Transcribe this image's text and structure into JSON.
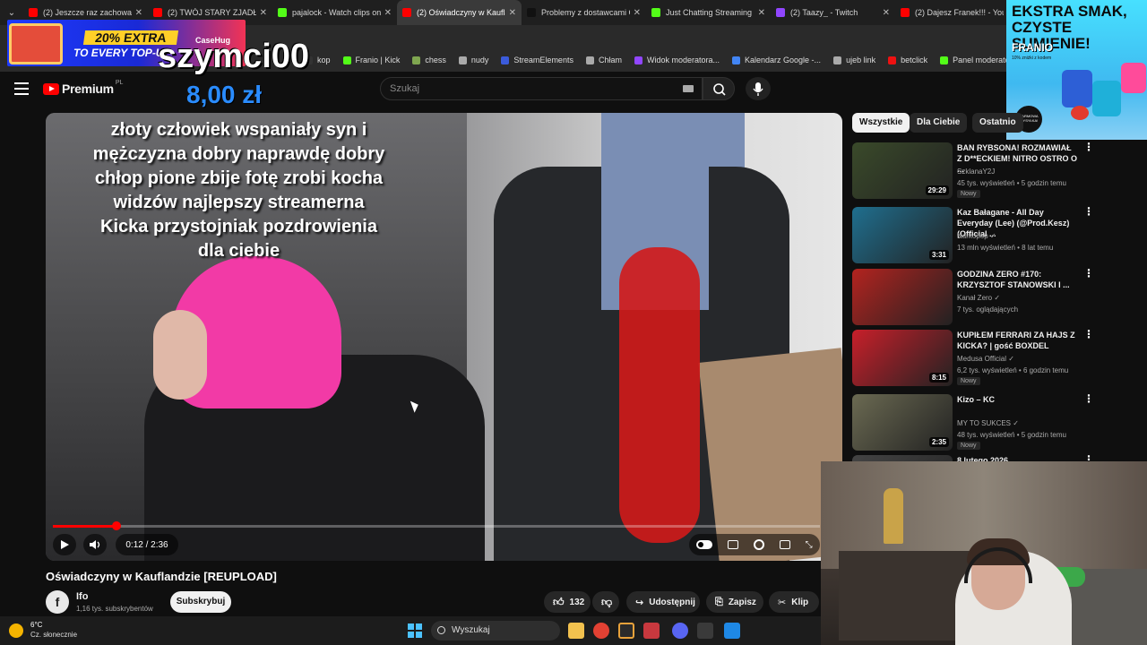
{
  "tabs": [
    {
      "title": "(2) Jeszcze raz zachowasz",
      "color": "#ff0000",
      "active": false
    },
    {
      "title": "(2) TWÓJ STARY ZJADŁ Ś",
      "color": "#ff0000",
      "active": false
    },
    {
      "title": "pajalock - Watch clips on",
      "color": "#53fc18",
      "active": false
    },
    {
      "title": "(2) Oświadczyny w Kaufla",
      "color": "#ff0000",
      "active": true
    },
    {
      "title": "Problemy z dostawcami G",
      "color": "#111111",
      "active": false
    },
    {
      "title": "Just Chatting Streaming",
      "color": "#53fc18",
      "active": false
    },
    {
      "title": "(2) Taazy_ - Twitch",
      "color": "#9146ff",
      "active": false
    },
    {
      "title": "(2) Dajesz Franek!!! - You",
      "color": "#ff0000",
      "active": false
    }
  ],
  "bookmarks": [
    {
      "label": "kop",
      "color": "#333333"
    },
    {
      "label": "Franio | Kick",
      "color": "#53fc18"
    },
    {
      "label": "chess",
      "color": "#7fa650"
    },
    {
      "label": "nudy",
      "color": "#aaaaaa"
    },
    {
      "label": "StreamElements",
      "color": "#3b5bdb"
    },
    {
      "label": "Chłam",
      "color": "#aaaaaa"
    },
    {
      "label": "Widok moderatora...",
      "color": "#9146ff"
    },
    {
      "label": "Kalendarz Google -...",
      "color": "#4285f4"
    },
    {
      "label": "ujeb link",
      "color": "#aaaaaa"
    },
    {
      "label": "betclick",
      "color": "#e11"
    },
    {
      "label": "Panel moderatora |...",
      "color": "#53fc18"
    }
  ],
  "header": {
    "logo_text": "Premium",
    "logo_region": "PL",
    "search_placeholder": "Szukaj"
  },
  "overlay": {
    "promo_line1": "20% EXTRA",
    "promo_line2": "TO EVERY TOP-UP",
    "promo_brand": "CaseHug",
    "donor_name": "szymci00",
    "donation_amount": "8,00 zł"
  },
  "ad": {
    "headline": "EKSTRA SMAK, CZYSTE SUMIENIE!",
    "brand": "FRANIO",
    "small": "10% zniżki z kodem",
    "badge": "DARMOWA WYSYŁKA!"
  },
  "video": {
    "caption": "złoty człowiek wspaniały syn i mężczyzna dobry naprawdę dobry chłop pione zbije fotę zrobi kocha widzów najlepszy streamerna Kicka przystojniak pozdrowienia dla ciebie",
    "time": "0:12 / 2:36",
    "progress": 0.083,
    "title": "Oświadczyny w Kauflandzie [REUPLOAD]",
    "channel_initial": "f",
    "channel": "Ifo",
    "subscribers": "1,16 tys. subskrybentów",
    "subscribe_label": "Subskrybuj",
    "likes": "132",
    "share_label": "Udostępnij",
    "save_label": "Zapisz",
    "clip_label": "Klip"
  },
  "chips": [
    "Wszystkie",
    "Dla Ciebie",
    "Ostatnio"
  ],
  "recommendations": [
    {
      "title": "BAN RYBSONA! ROZMAWIAŁ Z D**ECKIEM! NITRO OSTRO O ...",
      "channel": "SzklanaY2J",
      "meta": "45 tys. wyświetleń • 5 godzin temu",
      "badge": "Nowy",
      "duration": "29:29",
      "thumb": "#3a4a2a",
      "verified": false
    },
    {
      "title": "Kaz Bałagane - All Day Everyday (Lee) (@Prod.Kesz)(Official ...",
      "channel": "Narkopop",
      "meta": "13 mln wyświetleń • 8 lat temu",
      "badge": "",
      "duration": "3:31",
      "thumb": "#1f6f8f",
      "verified": true
    },
    {
      "title": "GODZINA ZERO #170: KRZYSZTOF STANOWSKI I ...",
      "channel": "Kanał Zero",
      "meta": "7 tys. oglądających",
      "badge": "",
      "duration": "",
      "thumb": "#b3231f",
      "verified": true
    },
    {
      "title": "KUPIŁEM FERRARI ZA HAJS Z KICKA? | gość BOXDEL",
      "channel": "Medusa Official",
      "meta": "6,2 tys. wyświetleń • 6 godzin temu",
      "badge": "Nowy",
      "duration": "8:15",
      "thumb": "#c81f2a",
      "verified": true
    },
    {
      "title": "Kizo – KC",
      "channel": "MY TO SUKCES",
      "meta": "48 tys. wyświetleń • 5 godzin temu",
      "badge": "Nowy",
      "duration": "2:35",
      "thumb": "#6b6a52",
      "verified": true
    },
    {
      "title": "8 lutego 2026",
      "channel": "",
      "meta": "",
      "badge": "",
      "duration": "",
      "thumb": "#444444",
      "verified": false
    }
  ],
  "taskbar": {
    "temp": "6°C",
    "weather": "Cz. słonecznie",
    "search": "Wyszukaj"
  }
}
